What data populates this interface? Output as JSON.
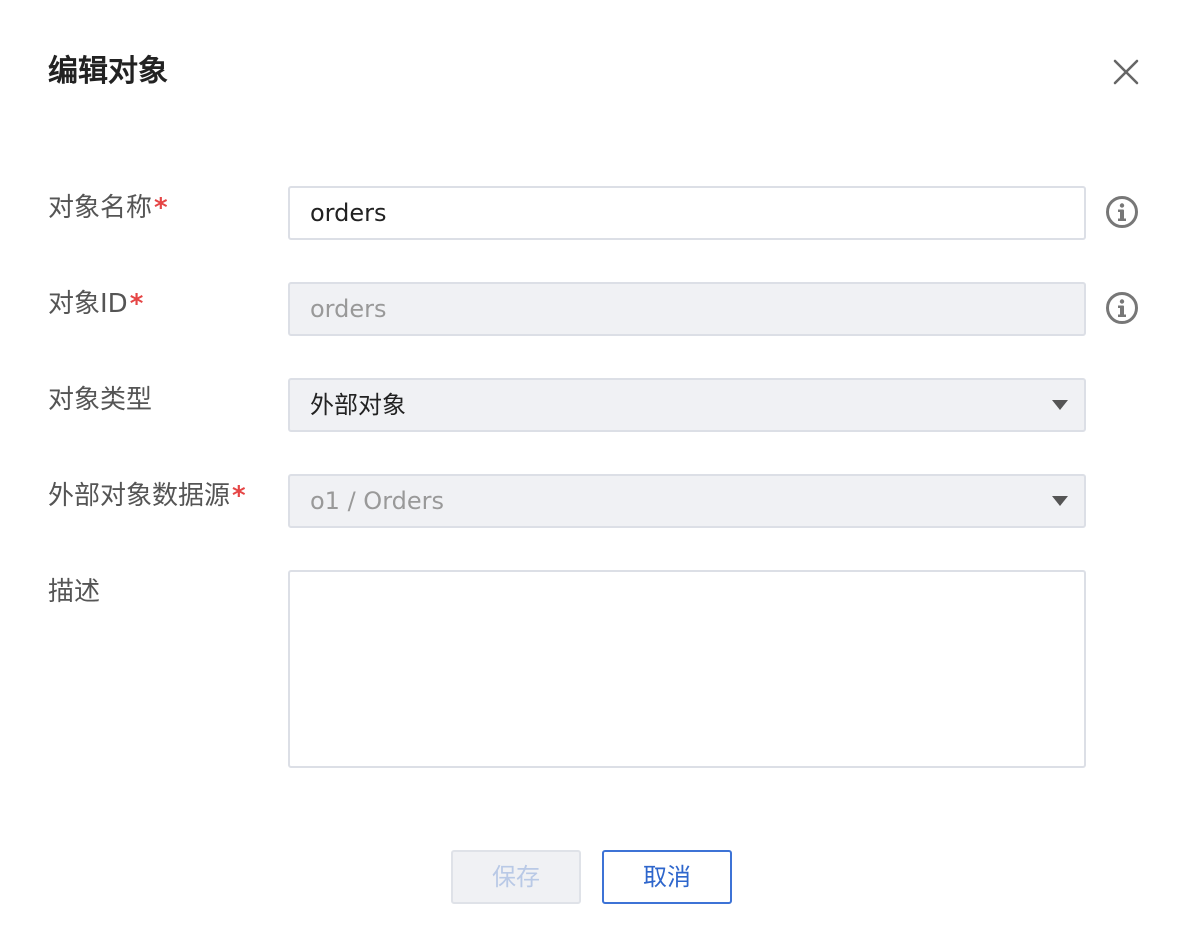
{
  "dialog": {
    "title": "编辑对象",
    "close_icon": "close-icon"
  },
  "form": {
    "name": {
      "label": "对象名称",
      "required_mark": "*",
      "value": "orders",
      "info_icon": "info-circle-icon"
    },
    "id": {
      "label": "对象ID",
      "required_mark": "*",
      "value": "orders",
      "disabled": true,
      "info_icon": "info-circle-icon"
    },
    "type": {
      "label": "对象类型",
      "selected": "外部对象"
    },
    "datasource": {
      "label": "外部对象数据源",
      "required_mark": "*",
      "selected": "o1 / Orders",
      "disabled": true
    },
    "description": {
      "label": "描述",
      "value": ""
    }
  },
  "actions": {
    "save_label": "保存",
    "cancel_label": "取消",
    "save_disabled": true
  },
  "colors": {
    "required": "#e54545",
    "primary": "#2e66cc",
    "disabled_bg": "#f0f1f4",
    "border": "#dcdfe6"
  }
}
